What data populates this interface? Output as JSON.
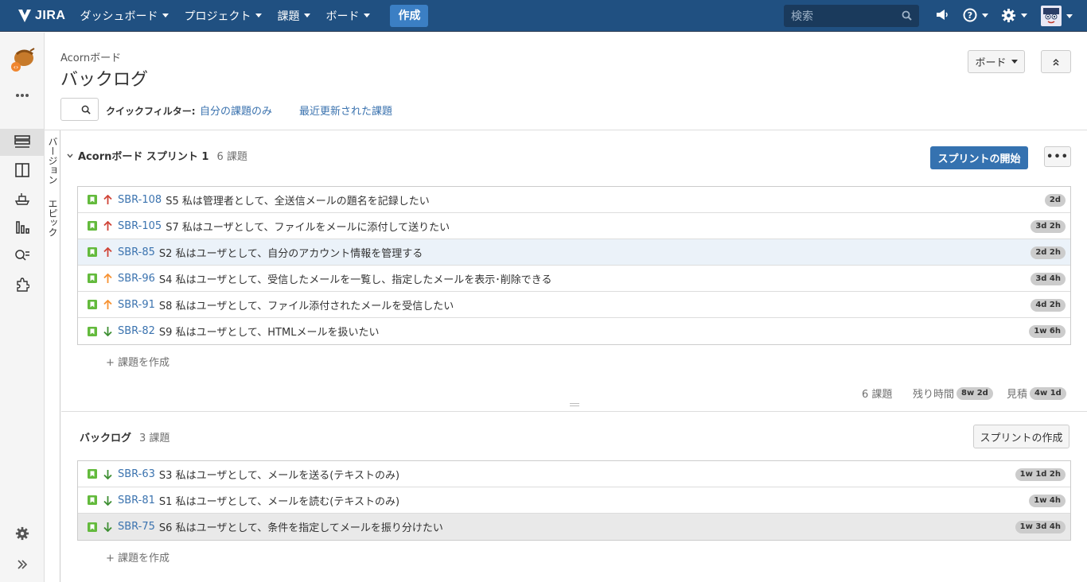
{
  "topnav": {
    "logo": "JIRA",
    "menus": [
      {
        "label": "ダッシュボード"
      },
      {
        "label": "プロジェクト"
      },
      {
        "label": "課題"
      },
      {
        "label": "ボード"
      }
    ],
    "create_label": "作成",
    "search_placeholder": "検索"
  },
  "header": {
    "board_name": "Acornボード",
    "title": "バックログ",
    "board_button": "ボード"
  },
  "quick_filters": {
    "label": "クイックフィルター:",
    "links": [
      "自分の課題のみ",
      "最近更新された課題"
    ]
  },
  "vertical_tabs": [
    "バージョン",
    "エピック"
  ],
  "sprint": {
    "name": "Acornボード スプリント 1",
    "count": "6 課題",
    "start_button": "スプリントの開始",
    "more_button": "•••",
    "issues": [
      {
        "key": "SBR-108",
        "summary": "S5 私は管理者として、全送信メールの題名を記録したい",
        "priority": "highest",
        "estimate": "2d"
      },
      {
        "key": "SBR-105",
        "summary": "S7 私はユーザとして、ファイルをメールに添付して送りたい",
        "priority": "highest",
        "estimate": "3d 2h"
      },
      {
        "key": "SBR-85",
        "summary": "S2 私はユーザとして、自分のアカウント情報を管理する",
        "priority": "highest",
        "estimate": "2d 2h"
      },
      {
        "key": "SBR-96",
        "summary": "S4 私はユーザとして、受信したメールを一覧し、指定したメールを表示･削除できる",
        "priority": "high",
        "estimate": "3d 4h"
      },
      {
        "key": "SBR-91",
        "summary": "S8 私はユーザとして、ファイル添付されたメールを受信したい",
        "priority": "high",
        "estimate": "4d 2h"
      },
      {
        "key": "SBR-82",
        "summary": "S9 私はユーザとして、HTMLメールを扱いたい",
        "priority": "low",
        "estimate": "1w 6h"
      }
    ],
    "create_issue": "+ 課題を作成",
    "footer": {
      "count": "6 課題",
      "remaining_label": "残り時間",
      "remaining": "8w 2d",
      "estimate_label": "見積",
      "estimate": "4w 1d"
    }
  },
  "backlog": {
    "name": "バックログ",
    "count": "3 課題",
    "create_sprint_button": "スプリントの作成",
    "issues": [
      {
        "key": "SBR-63",
        "summary": "S3 私はユーザとして、メールを送る(テキストのみ)",
        "priority": "low",
        "estimate": "1w 1d 2h"
      },
      {
        "key": "SBR-81",
        "summary": "S1 私はユーザとして、メールを読む(テキストのみ)",
        "priority": "low",
        "estimate": "1w 4h"
      },
      {
        "key": "SBR-75",
        "summary": "S6 私はユーザとして、条件を指定してメールを振り分けたい",
        "priority": "low",
        "estimate": "1w 3d 4h"
      }
    ],
    "create_issue": "+ 課題を作成"
  },
  "colors": {
    "nav_bg": "#205081",
    "link": "#3b73af",
    "primary_button": "#3572b0",
    "story_green": "#63ba3c",
    "priority_highest": "#d04437",
    "priority_high": "#f79232",
    "priority_low": "#3e8f33"
  }
}
